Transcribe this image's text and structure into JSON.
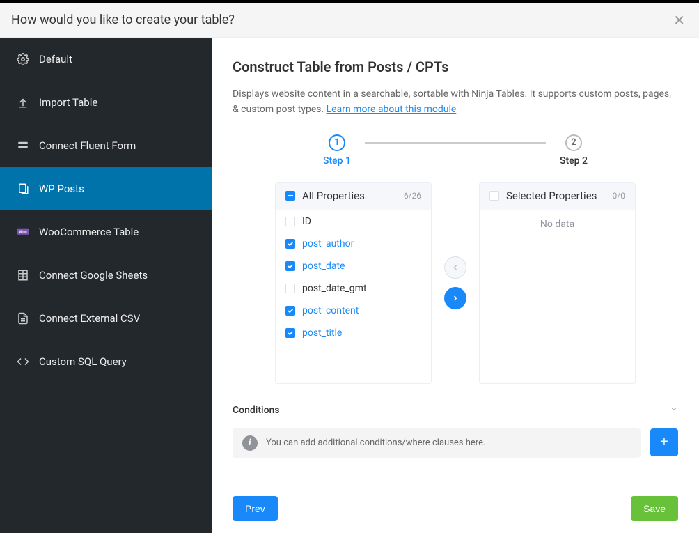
{
  "modal": {
    "title": "How would you like to create your table?"
  },
  "sidebar": {
    "items": [
      {
        "id": "default",
        "label": "Default"
      },
      {
        "id": "import",
        "label": "Import Table"
      },
      {
        "id": "fluent",
        "label": "Connect Fluent Form"
      },
      {
        "id": "wpposts",
        "label": "WP Posts"
      },
      {
        "id": "woo",
        "label": "WooCommerce Table"
      },
      {
        "id": "gsheets",
        "label": "Connect Google Sheets"
      },
      {
        "id": "csv",
        "label": "Connect External CSV"
      },
      {
        "id": "sql",
        "label": "Custom SQL Query"
      }
    ],
    "active": "wpposts"
  },
  "main": {
    "heading": "Construct Table from Posts / CPTs",
    "description": "Displays website content in a searchable, sortable with Ninja Tables. It supports custom posts, pages, & custom post types. ",
    "learn_more": "Learn more about this module",
    "step1": {
      "num": "1",
      "label": "Step 1"
    },
    "step2": {
      "num": "2",
      "label": "Step 2"
    },
    "left_panel": {
      "title": "All Properties",
      "count": "6/26",
      "items": [
        {
          "label": "ID",
          "checked": false
        },
        {
          "label": "post_author",
          "checked": true
        },
        {
          "label": "post_date",
          "checked": true
        },
        {
          "label": "post_date_gmt",
          "checked": false
        },
        {
          "label": "post_content",
          "checked": true
        },
        {
          "label": "post_title",
          "checked": true
        }
      ]
    },
    "right_panel": {
      "title": "Selected Properties",
      "count": "0/0",
      "empty_text": "No data"
    },
    "conditions": {
      "title": "Conditions",
      "hint": "You can add additional conditions/where clauses here.",
      "add": "+"
    },
    "footer": {
      "prev": "Prev",
      "save": "Save"
    }
  }
}
